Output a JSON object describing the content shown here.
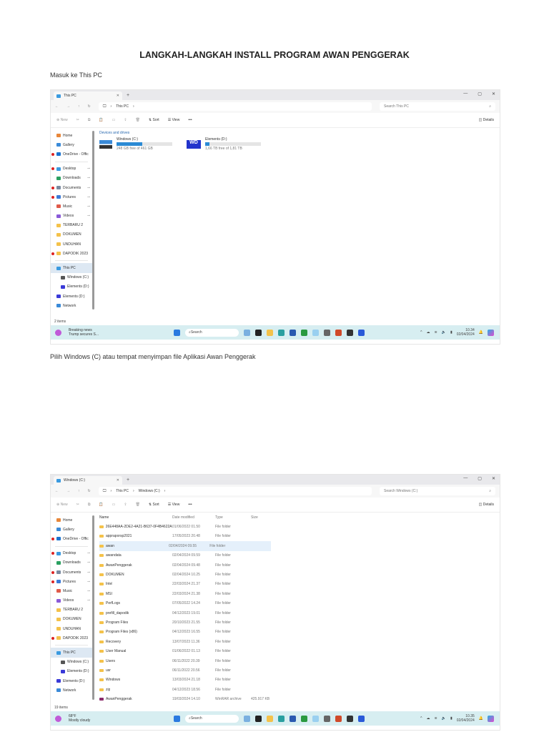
{
  "doc": {
    "title": "LANGKAH-LANGKAH INSTALL PROGRAM AWAN PENGGERAK",
    "step1": "Masuk ke This PC",
    "step2": "Pilih Windows (C) atau tempat menyimpan file Aplikasi Awan Penggerak"
  },
  "windows": [
    {
      "tab": "This PC",
      "path": [
        "This PC"
      ],
      "search": "Search This PC",
      "clock": {
        "time": "10.34",
        "date": "02/04/2024"
      },
      "news": {
        "line1": "Breaking news",
        "line2": "Trump secures S..."
      },
      "status": "2 items",
      "section": "Devices and drives",
      "drives": [
        {
          "name": "Windows (C:)",
          "free": "248 GB free of 461 GB",
          "used_fraction": 0.46,
          "icon": "windows-drive-icon"
        },
        {
          "name": "Elements (D:)",
          "free": "1,66 TB free of 1,81 TB",
          "used_fraction": 0.08,
          "icon": "wd-drive-icon"
        }
      ]
    },
    {
      "tab": "Windows (C:)",
      "path": [
        "This PC",
        "Windows (C:)"
      ],
      "search": "Search Windows (C:)",
      "clock": {
        "time": "10.35",
        "date": "02/04/2024"
      },
      "news": {
        "line1": "68°F",
        "line2": "Mostly cloudy"
      },
      "status": "19 items",
      "columns": [
        "Name",
        "Date modified",
        "Type",
        "Size"
      ],
      "files": [
        [
          "26E448AA-2DE2-4A21-B637-0F4B4622A...",
          "01/06/2022 01.50",
          "File folder",
          ""
        ],
        [
          "appraporsp2021",
          "17/05/2023 20.48",
          "File folder",
          ""
        ],
        [
          "awan",
          "02/04/2024 09.55",
          "File folder",
          ""
        ],
        [
          "awandata",
          "02/04/2024 09.59",
          "File folder",
          ""
        ],
        [
          "AwanPenggerak",
          "02/04/2024 09.48",
          "File folder",
          ""
        ],
        [
          "DOKUMEN",
          "02/04/2024 10.25",
          "File folder",
          ""
        ],
        [
          "Intel",
          "22/03/2024 21.37",
          "File folder",
          ""
        ],
        [
          "MSI",
          "22/03/2024 21.38",
          "File folder",
          ""
        ],
        [
          "PerfLogs",
          "07/05/2022 14.24",
          "File folder",
          ""
        ],
        [
          "prefill_dapodik",
          "04/12/2023 19.01",
          "File folder",
          ""
        ],
        [
          "Program Files",
          "20/10/2023 21.55",
          "File folder",
          ""
        ],
        [
          "Program Files (x86)",
          "04/12/2023 16.55",
          "File folder",
          ""
        ],
        [
          "Recovery",
          "13/07/2023 11.36",
          "File folder",
          ""
        ],
        [
          "User Manual",
          "01/06/2022 01.13",
          "File folder",
          ""
        ],
        [
          "Users",
          "06/11/2022 20.39",
          "File folder",
          ""
        ],
        [
          "usr",
          "06/11/2022 20.56",
          "File folder",
          ""
        ],
        [
          "Windows",
          "13/03/2024 21.18",
          "File folder",
          ""
        ],
        [
          "zip",
          "04/12/2023 18.56",
          "File folder",
          ""
        ],
        [
          "AwanPenggerak",
          "19/03/2024 14.10",
          "WinRAR archive",
          "425.917 KB"
        ]
      ]
    }
  ],
  "toolbar": {
    "new": "New",
    "sort": "Sort",
    "view": "View",
    "more": "•••",
    "details": "Details"
  },
  "taskbar": {
    "search": "Search"
  },
  "sidebar": [
    {
      "label": "Home",
      "color": "#e8873a"
    },
    {
      "label": "Gallery",
      "color": "#3a8ad8"
    },
    {
      "label": "OneDrive - Offic",
      "color": "#1a73d0",
      "badge": true
    },
    {
      "sep": true
    },
    {
      "label": "Desktop",
      "color": "#3a9ae0",
      "badge": true,
      "pin": true
    },
    {
      "label": "Downloads",
      "color": "#2aa060",
      "pin": true
    },
    {
      "label": "Documents",
      "color": "#7a8aa0",
      "badge": true,
      "pin": true
    },
    {
      "label": "Pictures",
      "color": "#3a7ad8",
      "badge": true,
      "pin": true
    },
    {
      "label": "Music",
      "color": "#e05a4a",
      "pin": true
    },
    {
      "label": "Videos",
      "color": "#8a5ad8",
      "pin": true
    },
    {
      "label": "TERBARU 2",
      "color": "#f4c24a"
    },
    {
      "label": "DOKUMEN",
      "color": "#f4c24a"
    },
    {
      "label": "UNDUHAN",
      "color": "#f4c24a"
    },
    {
      "label": "DAPODIK 2023",
      "color": "#f4c24a",
      "badge": true
    },
    {
      "sep": true
    },
    {
      "label": "This PC",
      "color": "#3a9ae0",
      "sel": true
    },
    {
      "label": "Windows (C:)",
      "color": "#555",
      "sub": true
    },
    {
      "label": "Elements (D:)",
      "color": "#3a3ad8",
      "sub": true
    },
    {
      "label": "Elements (D:)",
      "color": "#3a3ad8"
    },
    {
      "label": "Network",
      "color": "#3a8ad8"
    }
  ]
}
